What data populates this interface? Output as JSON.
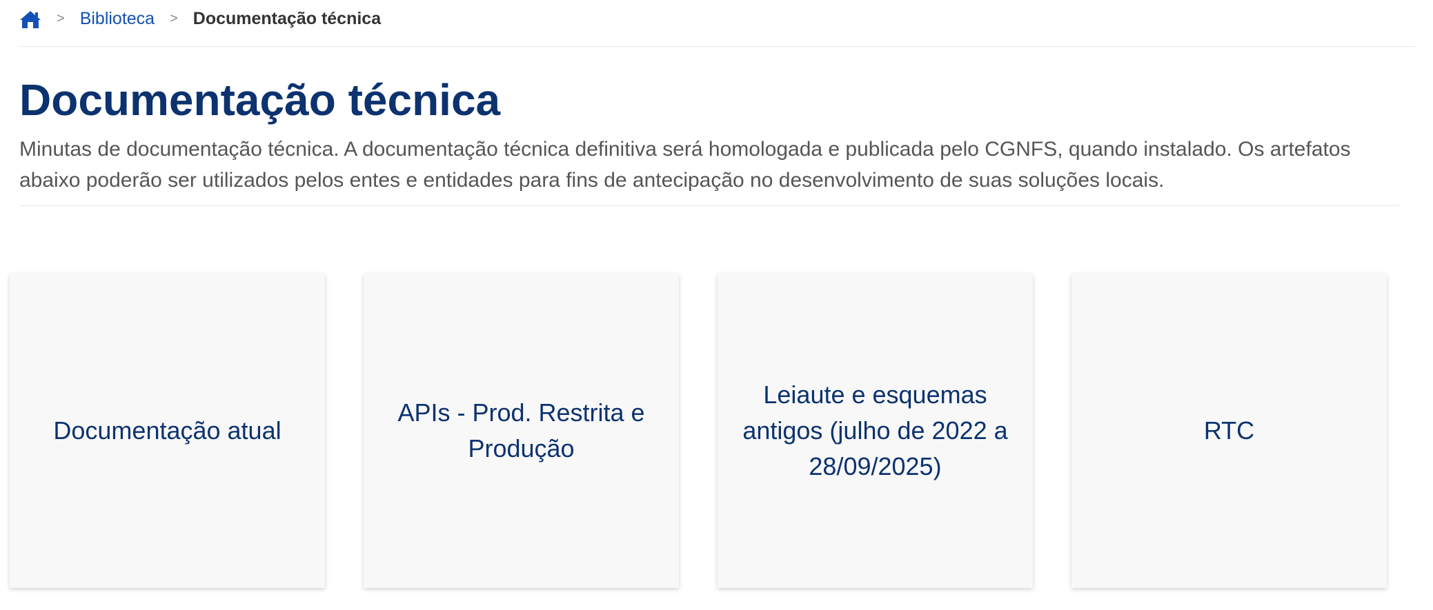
{
  "breadcrumb": {
    "home_icon": "home-icon",
    "separator": ">",
    "items": [
      {
        "label": "Biblioteca"
      },
      {
        "label": "Documentação técnica"
      }
    ]
  },
  "page": {
    "title": "Documentação técnica",
    "description": "Minutas de documentação técnica. A documentação técnica definitiva será homologada e publicada pelo CGNFS, quando instalado. Os artefatos abaixo poderão ser utilizados pelos entes e entidades para fins de antecipação no desenvolvimento de suas soluções locais."
  },
  "cards": [
    {
      "label": "Documentação atual"
    },
    {
      "label": "APIs - Prod. Restrita e Produção"
    },
    {
      "label": "Leiaute e esquemas antigos (julho de 2022 a 28/09/2025)"
    },
    {
      "label": "RTC"
    }
  ],
  "colors": {
    "link": "#1351b4",
    "title": "#0c326f",
    "card_background": "#f8f8f8"
  }
}
